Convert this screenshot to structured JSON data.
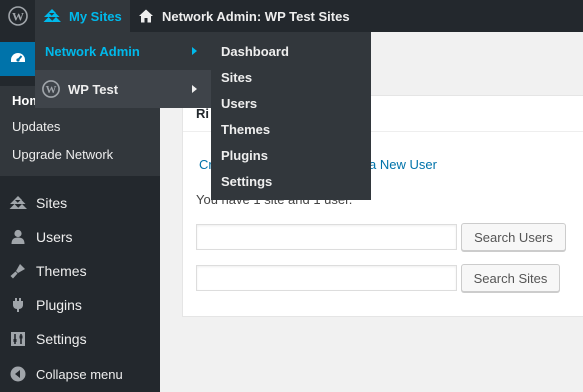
{
  "admin_bar": {
    "wp_logo_icon": "wordpress-logo-icon",
    "my_sites_label": "My Sites",
    "network_admin_label": "Network Admin: WP Test Sites"
  },
  "my_sites_menu": {
    "network_admin_label": "Network Admin",
    "site_label": "WP Test"
  },
  "network_admin_menu": {
    "items": [
      "Dashboard",
      "Sites",
      "Users",
      "Themes",
      "Plugins",
      "Settings"
    ]
  },
  "sidebar": {
    "dashboard_submenu": [
      "Home",
      "Updates",
      "Upgrade Network"
    ],
    "items": [
      {
        "label": "Sites",
        "icon": "sites-icon"
      },
      {
        "label": "Users",
        "icon": "users-icon"
      },
      {
        "label": "Themes",
        "icon": "themes-icon"
      },
      {
        "label": "Plugins",
        "icon": "plugins-icon"
      },
      {
        "label": "Settings",
        "icon": "settings-icon"
      }
    ],
    "collapse_label": "Collapse menu"
  },
  "right_now": {
    "title": "Ri",
    "create_link": "Cr",
    "new_user_link": "a New User",
    "count_text": "You have 1 site and 1 user.",
    "search_users_button": "Search Users",
    "search_sites_button": "Search Sites",
    "search_users_value": "",
    "search_sites_value": ""
  },
  "colors": {
    "bar": "#23282d",
    "submenu": "#32373c",
    "accent": "#00b9eb",
    "current": "#0073aa"
  }
}
